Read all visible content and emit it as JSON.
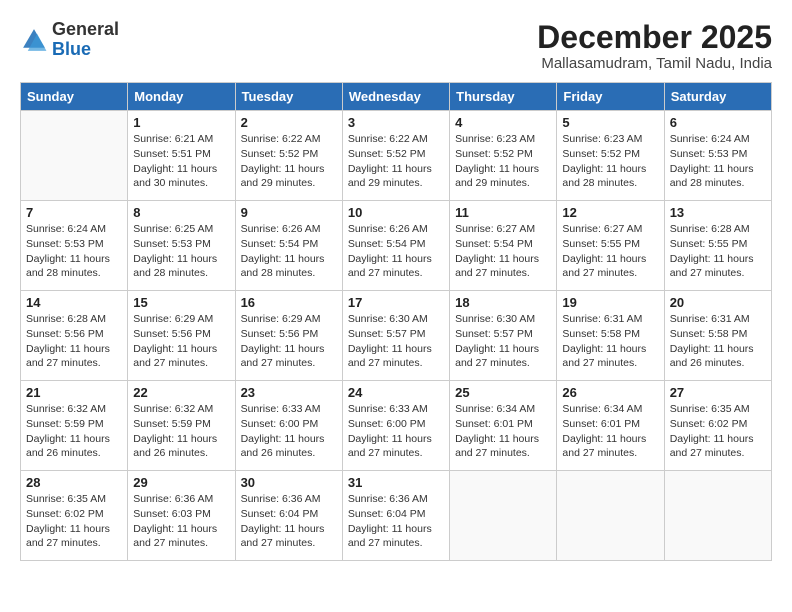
{
  "header": {
    "logo_general": "General",
    "logo_blue": "Blue",
    "month_title": "December 2025",
    "location": "Mallasamudram, Tamil Nadu, India"
  },
  "days_of_week": [
    "Sunday",
    "Monday",
    "Tuesday",
    "Wednesday",
    "Thursday",
    "Friday",
    "Saturday"
  ],
  "weeks": [
    [
      {
        "day": "",
        "info": ""
      },
      {
        "day": "1",
        "info": "Sunrise: 6:21 AM\nSunset: 5:51 PM\nDaylight: 11 hours\nand 30 minutes."
      },
      {
        "day": "2",
        "info": "Sunrise: 6:22 AM\nSunset: 5:52 PM\nDaylight: 11 hours\nand 29 minutes."
      },
      {
        "day": "3",
        "info": "Sunrise: 6:22 AM\nSunset: 5:52 PM\nDaylight: 11 hours\nand 29 minutes."
      },
      {
        "day": "4",
        "info": "Sunrise: 6:23 AM\nSunset: 5:52 PM\nDaylight: 11 hours\nand 29 minutes."
      },
      {
        "day": "5",
        "info": "Sunrise: 6:23 AM\nSunset: 5:52 PM\nDaylight: 11 hours\nand 28 minutes."
      },
      {
        "day": "6",
        "info": "Sunrise: 6:24 AM\nSunset: 5:53 PM\nDaylight: 11 hours\nand 28 minutes."
      }
    ],
    [
      {
        "day": "7",
        "info": "Sunrise: 6:24 AM\nSunset: 5:53 PM\nDaylight: 11 hours\nand 28 minutes."
      },
      {
        "day": "8",
        "info": "Sunrise: 6:25 AM\nSunset: 5:53 PM\nDaylight: 11 hours\nand 28 minutes."
      },
      {
        "day": "9",
        "info": "Sunrise: 6:26 AM\nSunset: 5:54 PM\nDaylight: 11 hours\nand 28 minutes."
      },
      {
        "day": "10",
        "info": "Sunrise: 6:26 AM\nSunset: 5:54 PM\nDaylight: 11 hours\nand 27 minutes."
      },
      {
        "day": "11",
        "info": "Sunrise: 6:27 AM\nSunset: 5:54 PM\nDaylight: 11 hours\nand 27 minutes."
      },
      {
        "day": "12",
        "info": "Sunrise: 6:27 AM\nSunset: 5:55 PM\nDaylight: 11 hours\nand 27 minutes."
      },
      {
        "day": "13",
        "info": "Sunrise: 6:28 AM\nSunset: 5:55 PM\nDaylight: 11 hours\nand 27 minutes."
      }
    ],
    [
      {
        "day": "14",
        "info": "Sunrise: 6:28 AM\nSunset: 5:56 PM\nDaylight: 11 hours\nand 27 minutes."
      },
      {
        "day": "15",
        "info": "Sunrise: 6:29 AM\nSunset: 5:56 PM\nDaylight: 11 hours\nand 27 minutes."
      },
      {
        "day": "16",
        "info": "Sunrise: 6:29 AM\nSunset: 5:56 PM\nDaylight: 11 hours\nand 27 minutes."
      },
      {
        "day": "17",
        "info": "Sunrise: 6:30 AM\nSunset: 5:57 PM\nDaylight: 11 hours\nand 27 minutes."
      },
      {
        "day": "18",
        "info": "Sunrise: 6:30 AM\nSunset: 5:57 PM\nDaylight: 11 hours\nand 27 minutes."
      },
      {
        "day": "19",
        "info": "Sunrise: 6:31 AM\nSunset: 5:58 PM\nDaylight: 11 hours\nand 27 minutes."
      },
      {
        "day": "20",
        "info": "Sunrise: 6:31 AM\nSunset: 5:58 PM\nDaylight: 11 hours\nand 26 minutes."
      }
    ],
    [
      {
        "day": "21",
        "info": "Sunrise: 6:32 AM\nSunset: 5:59 PM\nDaylight: 11 hours\nand 26 minutes."
      },
      {
        "day": "22",
        "info": "Sunrise: 6:32 AM\nSunset: 5:59 PM\nDaylight: 11 hours\nand 26 minutes."
      },
      {
        "day": "23",
        "info": "Sunrise: 6:33 AM\nSunset: 6:00 PM\nDaylight: 11 hours\nand 26 minutes."
      },
      {
        "day": "24",
        "info": "Sunrise: 6:33 AM\nSunset: 6:00 PM\nDaylight: 11 hours\nand 27 minutes."
      },
      {
        "day": "25",
        "info": "Sunrise: 6:34 AM\nSunset: 6:01 PM\nDaylight: 11 hours\nand 27 minutes."
      },
      {
        "day": "26",
        "info": "Sunrise: 6:34 AM\nSunset: 6:01 PM\nDaylight: 11 hours\nand 27 minutes."
      },
      {
        "day": "27",
        "info": "Sunrise: 6:35 AM\nSunset: 6:02 PM\nDaylight: 11 hours\nand 27 minutes."
      }
    ],
    [
      {
        "day": "28",
        "info": "Sunrise: 6:35 AM\nSunset: 6:02 PM\nDaylight: 11 hours\nand 27 minutes."
      },
      {
        "day": "29",
        "info": "Sunrise: 6:36 AM\nSunset: 6:03 PM\nDaylight: 11 hours\nand 27 minutes."
      },
      {
        "day": "30",
        "info": "Sunrise: 6:36 AM\nSunset: 6:04 PM\nDaylight: 11 hours\nand 27 minutes."
      },
      {
        "day": "31",
        "info": "Sunrise: 6:36 AM\nSunset: 6:04 PM\nDaylight: 11 hours\nand 27 minutes."
      },
      {
        "day": "",
        "info": ""
      },
      {
        "day": "",
        "info": ""
      },
      {
        "day": "",
        "info": ""
      }
    ]
  ]
}
